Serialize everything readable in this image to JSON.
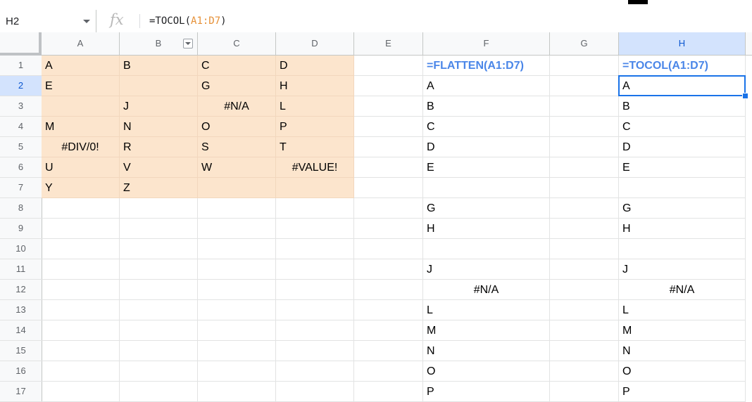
{
  "name_box": {
    "value": "H2"
  },
  "formula_bar": {
    "fx_label": "fx",
    "formula_prefix": "=TOCOL(",
    "formula_ref": "A1:D7",
    "formula_suffix": ")"
  },
  "columns": [
    {
      "label": "A",
      "width": 111
    },
    {
      "label": "B",
      "width": 111,
      "filter": true
    },
    {
      "label": "C",
      "width": 111
    },
    {
      "label": "D",
      "width": 111
    },
    {
      "label": "E",
      "width": 98
    },
    {
      "label": "F",
      "width": 180
    },
    {
      "label": "G",
      "width": 98
    },
    {
      "label": "H",
      "width": 180
    }
  ],
  "rows": [
    "1",
    "2",
    "3",
    "4",
    "5",
    "6",
    "7",
    "8",
    "9",
    "10",
    "11",
    "12",
    "13",
    "14",
    "15",
    "16",
    "17"
  ],
  "active_cell": {
    "col": "H",
    "row": "2"
  },
  "colors": {
    "source_fill": "#fce5cd",
    "formula_header_text": "#4a86e8",
    "selection": "#1a73e8",
    "range_ref": "#e69138"
  },
  "cells": [
    {
      "ref": "A1",
      "v": "A",
      "src": true
    },
    {
      "ref": "B1",
      "v": "B",
      "src": true
    },
    {
      "ref": "C1",
      "v": "C",
      "src": true
    },
    {
      "ref": "D1",
      "v": "D",
      "src": true
    },
    {
      "ref": "A2",
      "v": "E",
      "src": true
    },
    {
      "ref": "B2",
      "v": "",
      "src": true
    },
    {
      "ref": "C2",
      "v": "G",
      "src": true
    },
    {
      "ref": "D2",
      "v": "H",
      "src": true
    },
    {
      "ref": "A3",
      "v": "",
      "src": true
    },
    {
      "ref": "B3",
      "v": "J",
      "src": true
    },
    {
      "ref": "C3",
      "v": "#N/A",
      "src": true,
      "err": true
    },
    {
      "ref": "D3",
      "v": "L",
      "src": true
    },
    {
      "ref": "A4",
      "v": "M",
      "src": true
    },
    {
      "ref": "B4",
      "v": "N",
      "src": true
    },
    {
      "ref": "C4",
      "v": "O",
      "src": true
    },
    {
      "ref": "D4",
      "v": "P",
      "src": true
    },
    {
      "ref": "A5",
      "v": "#DIV/0!",
      "src": true,
      "err": true
    },
    {
      "ref": "B5",
      "v": "R",
      "src": true
    },
    {
      "ref": "C5",
      "v": "S",
      "src": true
    },
    {
      "ref": "D5",
      "v": "T",
      "src": true
    },
    {
      "ref": "A6",
      "v": "U",
      "src": true
    },
    {
      "ref": "B6",
      "v": "V",
      "src": true
    },
    {
      "ref": "C6",
      "v": "W",
      "src": true
    },
    {
      "ref": "D6",
      "v": "#VALUE!",
      "src": true,
      "err": true
    },
    {
      "ref": "A7",
      "v": "Y",
      "src": true
    },
    {
      "ref": "B7",
      "v": "Z",
      "src": true
    },
    {
      "ref": "C7",
      "v": "",
      "src": true
    },
    {
      "ref": "D7",
      "v": "",
      "src": true
    },
    {
      "ref": "F1",
      "v": "=FLATTEN(A1:D7)",
      "hdr": true
    },
    {
      "ref": "F2",
      "v": "A"
    },
    {
      "ref": "F3",
      "v": "B"
    },
    {
      "ref": "F4",
      "v": "C"
    },
    {
      "ref": "F5",
      "v": "D"
    },
    {
      "ref": "F6",
      "v": "E"
    },
    {
      "ref": "F7",
      "v": ""
    },
    {
      "ref": "F8",
      "v": "G"
    },
    {
      "ref": "F9",
      "v": "H"
    },
    {
      "ref": "F10",
      "v": ""
    },
    {
      "ref": "F11",
      "v": "J"
    },
    {
      "ref": "F12",
      "v": "#N/A",
      "err": true
    },
    {
      "ref": "F13",
      "v": "L"
    },
    {
      "ref": "F14",
      "v": "M"
    },
    {
      "ref": "F15",
      "v": "N"
    },
    {
      "ref": "F16",
      "v": "O"
    },
    {
      "ref": "F17",
      "v": "P"
    },
    {
      "ref": "H1",
      "v": "=TOCOL(A1:D7)",
      "hdr": true
    },
    {
      "ref": "H2",
      "v": "A"
    },
    {
      "ref": "H3",
      "v": "B"
    },
    {
      "ref": "H4",
      "v": "C"
    },
    {
      "ref": "H5",
      "v": "D"
    },
    {
      "ref": "H6",
      "v": "E"
    },
    {
      "ref": "H7",
      "v": ""
    },
    {
      "ref": "H8",
      "v": "G"
    },
    {
      "ref": "H9",
      "v": "H"
    },
    {
      "ref": "H10",
      "v": ""
    },
    {
      "ref": "H11",
      "v": "J"
    },
    {
      "ref": "H12",
      "v": "#N/A",
      "err": true
    },
    {
      "ref": "H13",
      "v": "L"
    },
    {
      "ref": "H14",
      "v": "M"
    },
    {
      "ref": "H15",
      "v": "N"
    },
    {
      "ref": "H16",
      "v": "O"
    },
    {
      "ref": "H17",
      "v": "P"
    }
  ]
}
